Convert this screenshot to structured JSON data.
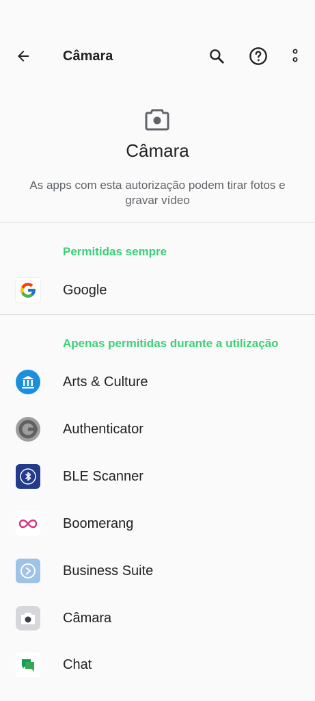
{
  "header": {
    "title": "Câmara",
    "back_icon": "arrow-back-icon",
    "search_icon": "search-icon",
    "help_icon": "help-icon",
    "more_icon": "more-vert-icon"
  },
  "permission": {
    "icon": "camera-icon",
    "title": "Câmara",
    "description": "As apps com esta autorização podem tirar fotos e gravar vídeo"
  },
  "sections": {
    "always": {
      "title": "Permitidas sempre",
      "apps": [
        {
          "label": "Google",
          "icon": "google-icon"
        }
      ]
    },
    "while_using": {
      "title": "Apenas permitidas durante a utilização",
      "apps": [
        {
          "label": "Arts & Culture",
          "icon": "arts-culture-icon"
        },
        {
          "label": "Authenticator",
          "icon": "authenticator-icon"
        },
        {
          "label": "BLE Scanner",
          "icon": "bluetooth-icon"
        },
        {
          "label": "Boomerang",
          "icon": "boomerang-icon"
        },
        {
          "label": "Business Suite",
          "icon": "business-suite-icon"
        },
        {
          "label": "Câmara",
          "icon": "camera-app-icon"
        },
        {
          "label": "Chat",
          "icon": "chat-icon"
        }
      ]
    }
  },
  "colors": {
    "accent": "#3ccf78",
    "text": "#202124",
    "secondary_text": "#5f6368",
    "background": "#fafafa"
  }
}
